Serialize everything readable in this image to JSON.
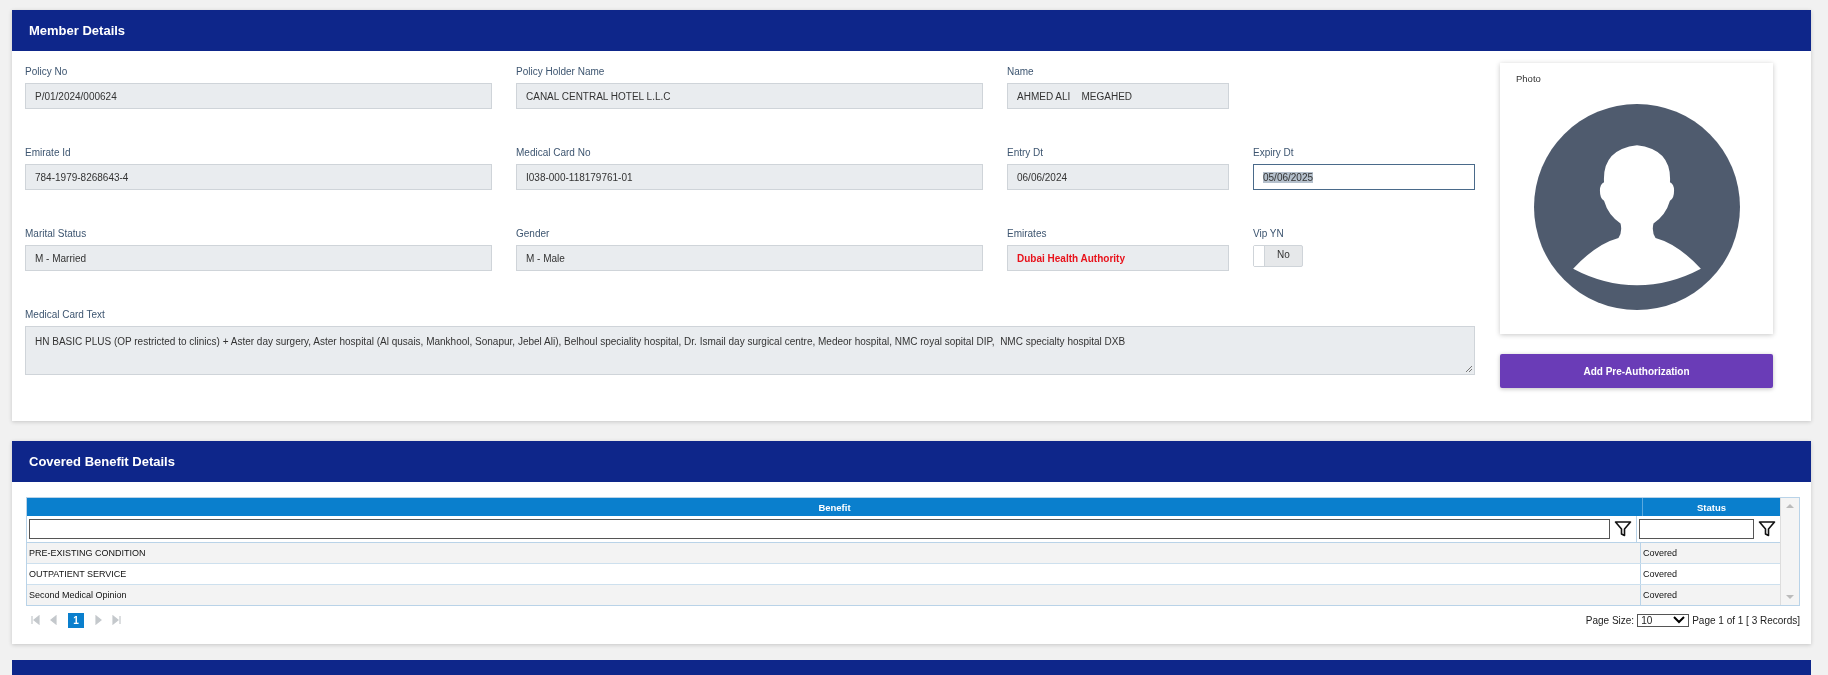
{
  "member_details": {
    "title": "Member Details",
    "rows": [
      [
        {
          "label": "Policy No",
          "value": "P/01/2024/000624",
          "kind": "text",
          "focused": false,
          "alert": false
        },
        {
          "label": "Policy Holder Name",
          "value": "CANAL CENTRAL HOTEL L.L.C",
          "kind": "text",
          "focused": false,
          "alert": false
        },
        {
          "label": "Name",
          "value": "AHMED ALI    MEGAHED",
          "kind": "text",
          "focused": false,
          "alert": false
        }
      ],
      [
        {
          "label": "Emirate Id",
          "value": "784-1979-8268643-4",
          "kind": "text",
          "focused": false,
          "alert": false
        },
        {
          "label": "Medical Card No",
          "value": "I038-000-118179761-01",
          "kind": "text",
          "focused": false,
          "alert": false
        },
        {
          "label": "Entry Dt",
          "value": "06/06/2024",
          "kind": "text",
          "focused": false,
          "alert": false
        },
        {
          "label": "Expiry Dt",
          "value": "05/06/2025",
          "kind": "text",
          "focused": true,
          "alert": false
        }
      ],
      [
        {
          "label": "Marital Status",
          "value": "M - Married",
          "kind": "text",
          "focused": false,
          "alert": false
        },
        {
          "label": "Gender",
          "value": "M - Male",
          "kind": "text",
          "focused": false,
          "alert": false
        },
        {
          "label": "Emirates",
          "value": "Dubai Health Authority",
          "kind": "text",
          "focused": false,
          "alert": true
        },
        {
          "label": "Vip YN",
          "value": "No",
          "kind": "toggle",
          "on": false
        }
      ],
      [
        {
          "label": "Medical Card Text",
          "value": "HN BASIC PLUS (OP restricted to clinics) + Aster day surgery, Aster hospital (Al qusais, Mankhool, Sonapur, Jebel Ali), Belhoul speciality hospital, Dr. Ismail day surgical centre, Medeor hospital, NMC royal sopital DIP,  NMC specialty hospital DXB",
          "kind": "textarea",
          "focused": false,
          "alert": false
        }
      ]
    ],
    "photo": {
      "label": "Photo"
    },
    "button": "Add Pre-Authorization"
  },
  "covered_benefits": {
    "title": "Covered Benefit Details",
    "table": {
      "columns": [
        "Benefit",
        "Status"
      ],
      "rows": [
        [
          "PRE-EXISTING CONDITION",
          "Covered"
        ],
        [
          "OUTPATIENT SERVICE",
          "Covered"
        ],
        [
          "Second Medical Opinion",
          "Covered"
        ]
      ]
    },
    "pager": {
      "nav": [
        {
          "kind": "first",
          "disabled": true
        },
        {
          "kind": "prev",
          "disabled": true
        },
        {
          "kind": "next",
          "disabled": true
        },
        {
          "kind": "last",
          "disabled": true
        }
      ],
      "pages": [
        {
          "label": "1",
          "selected": true
        }
      ],
      "page_size_label": "Page Size:",
      "page_size": "10",
      "summary": "Page 1 of 1 [ 3 Records]"
    }
  }
}
